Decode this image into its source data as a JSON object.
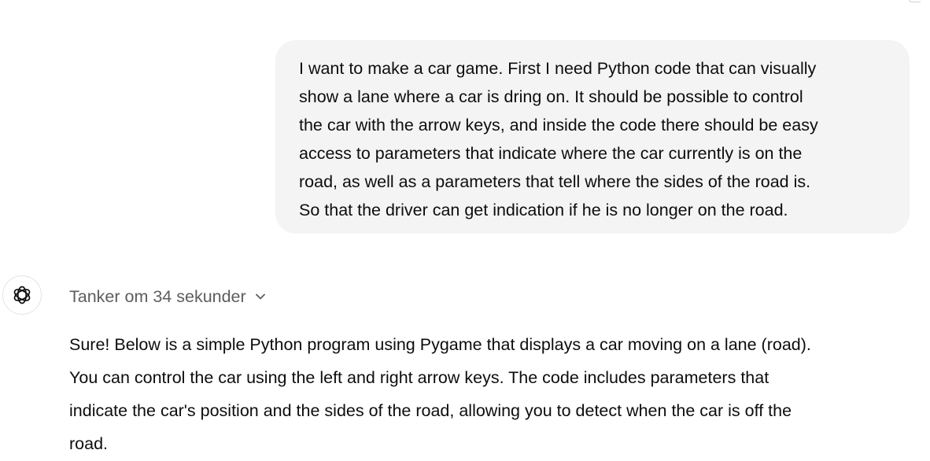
{
  "user_message": {
    "lines": [
      "I want to make a car game. First I need Python code that can visually",
      "show a lane where a car is dring on. It should be possible to control",
      "the car with the arrow keys, and inside the code there should be easy",
      "access to parameters that indicate where the car currently is on the",
      "road, as well as a parameters that tell where the sides of the road is.",
      "So that the driver can get indication if he is no longer on the road."
    ]
  },
  "assistant": {
    "avatar_icon": "openai-logo-icon",
    "thinking_label": "Tanker om 34 sekunder",
    "thinking_toggle_icon": "chevron-down-icon",
    "response_lines": [
      "Sure! Below is a simple Python program using Pygame that displays a car moving on a lane (road).",
      "You can control the car using the left and right arrow keys. The code includes parameters that",
      "indicate the car's position and the sides of the road, allowing you to detect when the car is off the",
      "road."
    ]
  },
  "colors": {
    "user_bubble_bg": "#f4f4f4",
    "text": "#0d0d0d",
    "muted_text": "#5d5d5d",
    "avatar_border": "#e3e3e3"
  }
}
